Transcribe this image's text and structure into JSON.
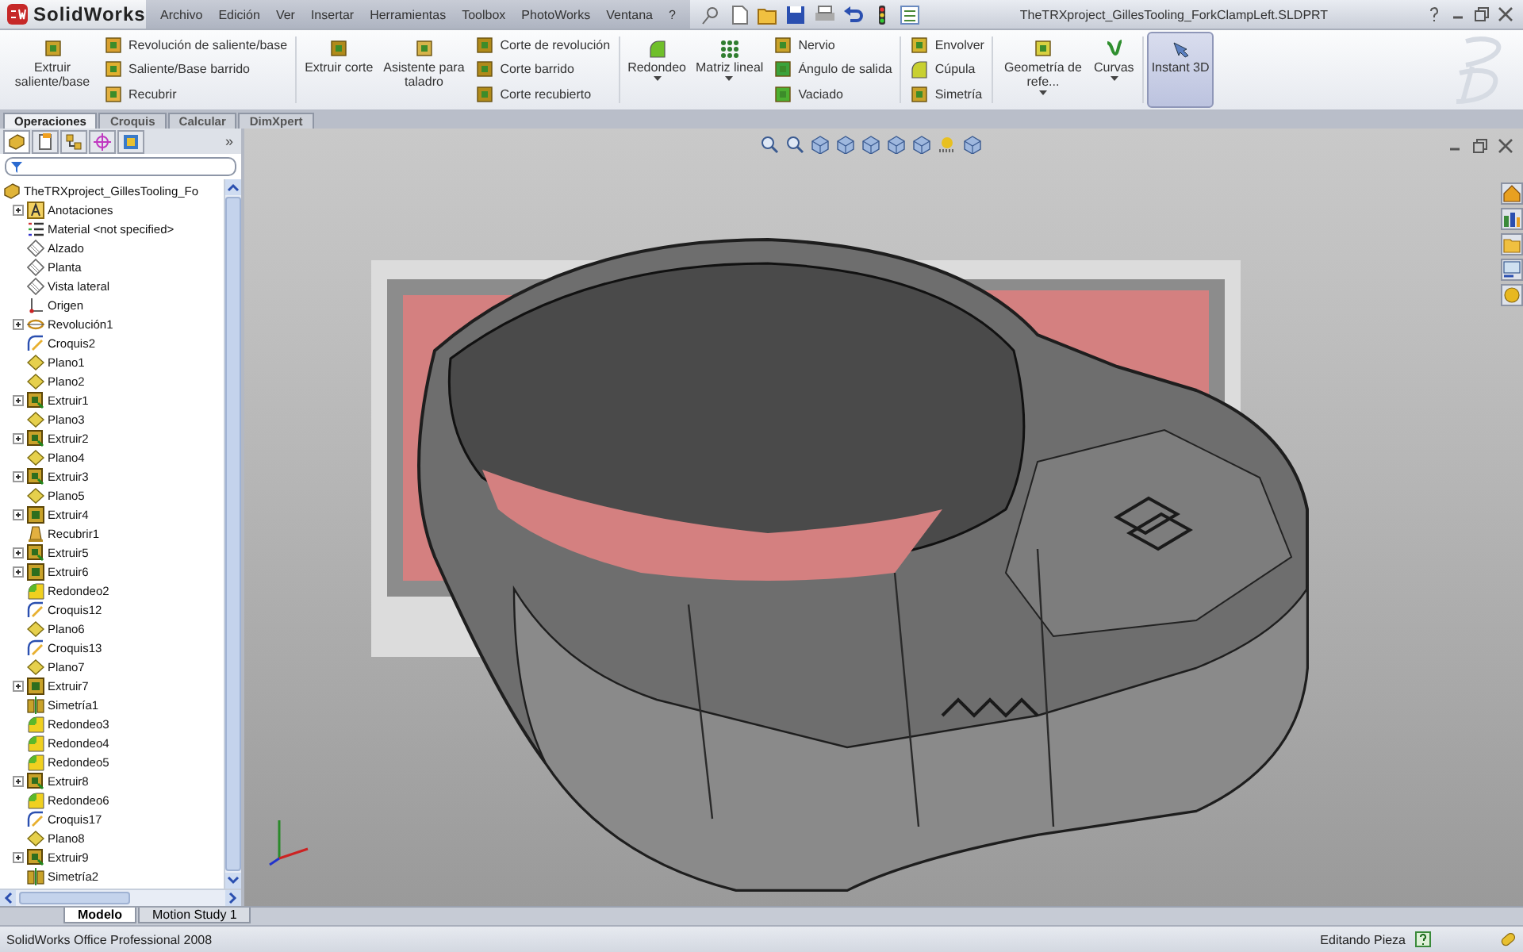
{
  "app": {
    "logo": "SolidWorks",
    "menu": [
      "Archivo",
      "Edición",
      "Ver",
      "Insertar",
      "Herramientas",
      "Toolbox",
      "PhotoWorks",
      "Ventana",
      "?"
    ],
    "title": "TheTRXproject_GillesTooling_ForkClampLeft.SLDPRT"
  },
  "ribbon": [
    {
      "kind": "large",
      "label": "Extruir saliente/base",
      "dropdown": false,
      "selected": false
    },
    {
      "kind": "stack",
      "items": [
        {
          "label": "Revolución de saliente/base"
        },
        {
          "label": "Saliente/Base barrido"
        },
        {
          "label": "Recubrir"
        }
      ]
    },
    {
      "kind": "large",
      "label": "Extruir corte",
      "dropdown": false,
      "selected": false
    },
    {
      "kind": "large",
      "label": "Asistente para taladro",
      "dropdown": false,
      "selected": false
    },
    {
      "kind": "stack",
      "items": [
        {
          "label": "Corte de revolución"
        },
        {
          "label": "Corte barrido"
        },
        {
          "label": "Corte recubierto"
        }
      ]
    },
    {
      "kind": "large",
      "label": "Redondeo",
      "dropdown": true,
      "selected": false
    },
    {
      "kind": "large",
      "label": "Matriz lineal",
      "dropdown": true,
      "selected": false
    },
    {
      "kind": "stack",
      "items": [
        {
          "label": "Nervio"
        },
        {
          "label": "Ángulo de salida"
        },
        {
          "label": "Vaciado"
        }
      ]
    },
    {
      "kind": "stack",
      "items": [
        {
          "label": "Envolver"
        },
        {
          "label": "Cúpula"
        },
        {
          "label": "Simetría"
        }
      ]
    },
    {
      "kind": "large",
      "label": "Geometría de refe...",
      "dropdown": true,
      "selected": false
    },
    {
      "kind": "large",
      "label": "Curvas",
      "dropdown": true,
      "selected": false
    },
    {
      "kind": "large",
      "label": "Instant 3D",
      "dropdown": false,
      "selected": true
    }
  ],
  "command_tabs": [
    {
      "label": "Operaciones",
      "selected": true
    },
    {
      "label": "Croquis",
      "selected": false
    },
    {
      "label": "Calcular",
      "selected": false
    },
    {
      "label": "DimXpert",
      "selected": false
    }
  ],
  "feature_tree": {
    "panel_tabs": [
      {
        "selected": true
      },
      {
        "selected": false
      },
      {
        "selected": false
      },
      {
        "selected": false
      },
      {
        "selected": false
      }
    ],
    "more": "»",
    "root": {
      "label": "TheTRXproject_GillesTooling_Fo",
      "children": [
        {
          "label": "Anotaciones",
          "kind": "annotations",
          "expandable": true
        },
        {
          "label": "Material <not specified>",
          "kind": "material",
          "expandable": false
        },
        {
          "label": "Alzado",
          "kind": "refplane",
          "expandable": false
        },
        {
          "label": "Planta",
          "kind": "refplane",
          "expandable": false
        },
        {
          "label": "Vista lateral",
          "kind": "refplane",
          "expandable": false
        },
        {
          "label": "Origen",
          "kind": "origin",
          "expandable": false
        },
        {
          "label": "Revolución1",
          "kind": "revolve",
          "expandable": true
        },
        {
          "label": "Croquis2",
          "kind": "sketch",
          "expandable": false
        },
        {
          "label": "Plano1",
          "kind": "plane",
          "expandable": false
        },
        {
          "label": "Plano2",
          "kind": "plane",
          "expandable": false
        },
        {
          "label": "Extruir1",
          "kind": "boss",
          "expandable": true
        },
        {
          "label": "Plano3",
          "kind": "plane",
          "expandable": false
        },
        {
          "label": "Extruir2",
          "kind": "boss",
          "expandable": true
        },
        {
          "label": "Plano4",
          "kind": "plane",
          "expandable": false
        },
        {
          "label": "Extruir3",
          "kind": "boss",
          "expandable": true
        },
        {
          "label": "Plano5",
          "kind": "plane",
          "expandable": false
        },
        {
          "label": "Extruir4",
          "kind": "cut",
          "expandable": true
        },
        {
          "label": "Recubrir1",
          "kind": "loft",
          "expandable": false
        },
        {
          "label": "Extruir5",
          "kind": "boss",
          "expandable": true
        },
        {
          "label": "Extruir6",
          "kind": "cut",
          "expandable": true
        },
        {
          "label": "Redondeo2",
          "kind": "fillet",
          "expandable": false
        },
        {
          "label": "Croquis12",
          "kind": "sketch",
          "expandable": false
        },
        {
          "label": "Plano6",
          "kind": "plane",
          "expandable": false
        },
        {
          "label": "Croquis13",
          "kind": "sketch",
          "expandable": false
        },
        {
          "label": "Plano7",
          "kind": "plane",
          "expandable": false
        },
        {
          "label": "Extruir7",
          "kind": "cut",
          "expandable": true
        },
        {
          "label": "Simetría1",
          "kind": "mirror",
          "expandable": false
        },
        {
          "label": "Redondeo3",
          "kind": "fillet",
          "expandable": false
        },
        {
          "label": "Redondeo4",
          "kind": "fillet",
          "expandable": false
        },
        {
          "label": "Redondeo5",
          "kind": "fillet",
          "expandable": false
        },
        {
          "label": "Extruir8",
          "kind": "boss",
          "expandable": true
        },
        {
          "label": "Redondeo6",
          "kind": "fillet",
          "expandable": false
        },
        {
          "label": "Croquis17",
          "kind": "sketch",
          "expandable": false
        },
        {
          "label": "Plano8",
          "kind": "plane",
          "expandable": false
        },
        {
          "label": "Extruir9",
          "kind": "boss",
          "expandable": true
        },
        {
          "label": "Simetría2",
          "kind": "mirror",
          "expandable": false
        }
      ]
    }
  },
  "bottom_tabs": [
    {
      "label": "Modelo",
      "selected": true
    },
    {
      "label": "Motion Study 1",
      "selected": false
    }
  ],
  "status_bar": {
    "product": "SolidWorks Office Professional 2008",
    "mode": "Editando Pieza"
  }
}
